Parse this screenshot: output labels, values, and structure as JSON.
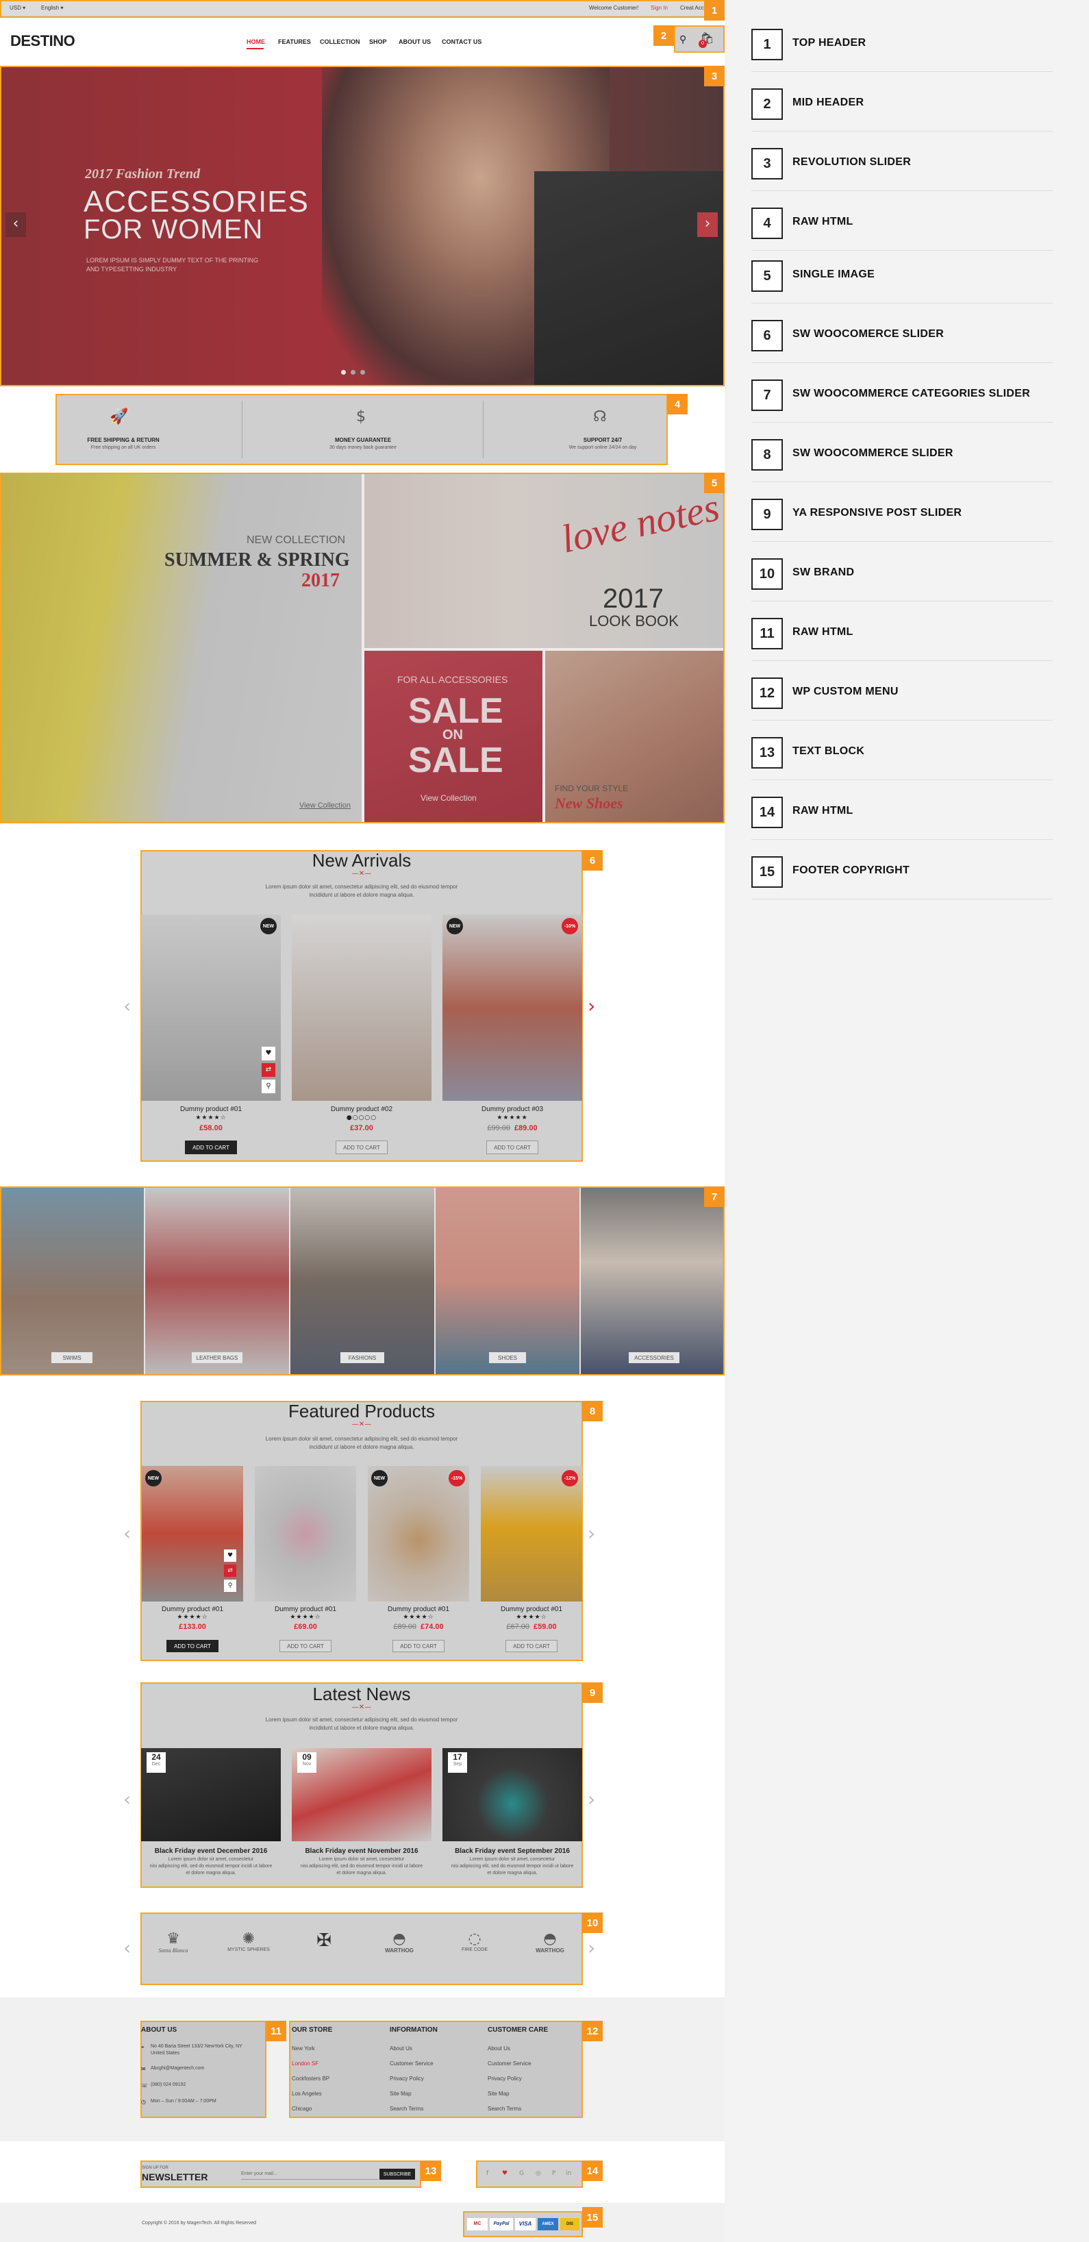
{
  "top_header": {
    "currency": "USD ▾",
    "language": "English ▾",
    "welcome": "Welcome Customer!",
    "signin": "Sign In",
    "create": "Creat Acc"
  },
  "mid_header": {
    "logo": "DESTINO",
    "nav": [
      "HOME",
      "FEATURES",
      "COLLECTION",
      "SHOP",
      "ABOUT US",
      "CONTACT US"
    ],
    "cart_count": "0"
  },
  "slider": {
    "kicker": "2017 Fashion Trend",
    "title1": "ACCESSORIES",
    "title2": "FOR WOMEN",
    "desc1": "LOREM IPSUM IS SIMPLY DUMMY TEXT OF THE PRINTING",
    "desc2": "AND TYPESETTING INDUSTRY"
  },
  "features": [
    {
      "title": "FREE SHIPPING & RETURN",
      "sub": "Free shipping on all UK orders"
    },
    {
      "title": "MONEY GUARANTEE",
      "sub": "30 days money back guarantee"
    },
    {
      "title": "SUPPORT 24/7",
      "sub": "We support online 24/24 on day"
    }
  ],
  "banners": {
    "new_collection": "NEW COLLECTION",
    "summer": "SUMMER & SPRING",
    "year": "2017",
    "view1": "View Collection",
    "love": "love notes",
    "lookbook_year": "2017",
    "lookbook": "LOOK BOOK",
    "for_all": "FOR ALL ACCESSORIES",
    "sale1": "SALE",
    "on": "ON",
    "sale2": "SALE",
    "view2": "View Collection",
    "find": "FIND YOUR STYLE",
    "new_shoes": "New Shoes"
  },
  "new_arrivals": {
    "title": "New Arrivals",
    "sub1": "Lorem ipsum dolor sit amet, consectetur adipiscing elit, sed do eiusmod tempor",
    "sub2": "incididunt ut labore et dolore magna aliqua.",
    "products": [
      {
        "name": "Dummy product #01",
        "price": "£58.00",
        "old": "",
        "stars": "★★★★☆",
        "badge": "NEW",
        "btn": "ADD TO CART"
      },
      {
        "name": "Dummy product #02",
        "price": "£37.00",
        "old": "",
        "stars": "●○○○○",
        "badge": "",
        "btn": "ADD TO CART"
      },
      {
        "name": "Dummy product #03",
        "price": "£89.00",
        "old": "£99.00",
        "stars": "★★★★★",
        "badge": "NEW",
        "sale": "-10%",
        "btn": "ADD TO CART"
      }
    ]
  },
  "categories": [
    "SWIMS",
    "LEATHER BAGS",
    "FASHIONS",
    "SHOES",
    "ACCESSORIES"
  ],
  "featured": {
    "title": "Featured Products",
    "sub1": "Lorem ipsum dolor sit amet, consectetur adipiscing elit, sed do eiusmod tempor",
    "sub2": "incididunt ut labore et dolore magna aliqua.",
    "products": [
      {
        "name": "Dummy product #01",
        "price": "£133.00",
        "old": "",
        "stars": "★★★★☆",
        "badge": "NEW",
        "btn": "ADD TO CART"
      },
      {
        "name": "Dummy product #01",
        "price": "£69.00",
        "old": "",
        "stars": "★★★★☆",
        "badge": "",
        "btn": "ADD TO CART"
      },
      {
        "name": "Dummy product #01",
        "price": "£74.00",
        "old": "£89.00",
        "stars": "★★★★☆",
        "badge": "NEW",
        "sale": "-15%",
        "btn": "ADD TO CART"
      },
      {
        "name": "Dummy product #01",
        "price": "£59.00",
        "old": "£67.00",
        "stars": "★★★★☆",
        "badge": "",
        "sale": "-12%",
        "btn": "ADD TO CART"
      }
    ]
  },
  "news": {
    "title": "Latest News",
    "sub1": "Lorem ipsum dolor sit amet, consectetur adipiscing elit, sed do eiusmod tempor",
    "sub2": "incididunt ut labore et dolore magna aliqua.",
    "posts": [
      {
        "day": "24",
        "month": "Dec",
        "title": "Black Friday event December 2016",
        "l1": "Lorem ipsum dolor sit amet, consectetur",
        "l2": "nisi adipiscing elit, sed do eiusmod tempor incidi ut labore",
        "l3": "et dolore magna aliqua."
      },
      {
        "day": "09",
        "month": "Nov",
        "title": "Black Friday event November 2016",
        "l1": "Lorem ipsum dolor sit amet, consectetur",
        "l2": "nisi adipiscing elit, sed do eiusmod tempor incidi ut labore",
        "l3": "et dolore magna aliqua."
      },
      {
        "day": "17",
        "month": "Sep",
        "title": "Black Friday event September 2016",
        "l1": "Lorem ipsum dolor sit amet, consectetur",
        "l2": "nisi adipiscing elit, sed do eiusmod tempor incidi ut labore",
        "l3": "et dolore magna aliqua."
      }
    ]
  },
  "brands": [
    "Santa Blanca",
    "MYSTIC SPHERES",
    "",
    "WARTHOG",
    "FIRE CODE",
    "WARTHOG"
  ],
  "footer": {
    "about_title": "ABOUT US",
    "address1": "No 40 Baria Street 133/2 NewYork City, NY",
    "address2": "United States",
    "email": "Abcghi@Magentech.com",
    "phone": "(080) 024 09192",
    "hours": "Mon – Sun / 9:00AM – 7:00PM",
    "store_title": "OUR STORE",
    "store": [
      "New York",
      "London SF",
      "Cockfosters BP",
      "Los Angeles",
      "Chicago"
    ],
    "info_title": "INFORMATION",
    "info": [
      "About Us",
      "Customer Service",
      "Privacy Policy",
      "Site Map",
      "Search Terms"
    ],
    "care_title": "CUSTOMER CARE",
    "care": [
      "About Us",
      "Customer Service",
      "Privacy Policy",
      "Site Map",
      "Search Terms"
    ],
    "signup": "SIGN UP FOR",
    "newsletter": "NEWSLETTER",
    "email_placeholder": "Enter your mail...",
    "subscribe": "SUBSCRIBE",
    "social": [
      "f",
      "♥",
      "G",
      "◎",
      "P",
      "in"
    ],
    "copyright": "Copyright © 2016 by MagenTech. All Rights Reserved",
    "payments": [
      "MC",
      "PayPal",
      "VISA",
      "AMEX",
      "DIS"
    ]
  },
  "legend": [
    "TOP HEADER",
    "MID HEADER",
    "REVOLUTION SLIDER",
    "RAW HTML",
    "SINGLE IMAGE",
    "SW WOOCOMERCE SLIDER",
    "SW WOOCOMMERCE CATEGORIES SLIDER",
    "SW WOOCOMMERCE SLIDER",
    "YA RESPONSIVE POST SLIDER",
    "SW BRAND",
    "RAW HTML",
    "WP CUSTOM MENU",
    "TEXT BLOCK",
    "RAW HTML",
    "FOOTER COPYRIGHT"
  ],
  "colors": {
    "accent": "#f7941d",
    "red": "#d9232d",
    "dark": "#222222"
  }
}
